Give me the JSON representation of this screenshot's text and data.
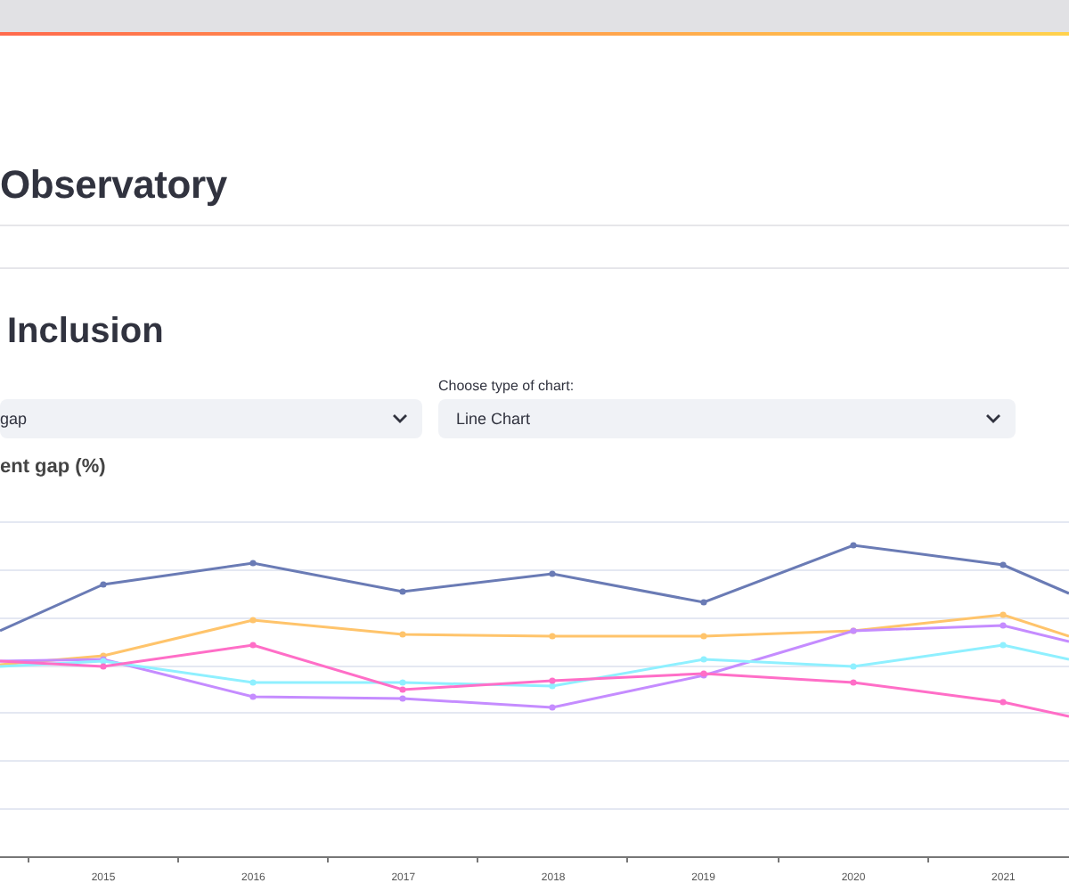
{
  "header": {
    "title": "Observatory"
  },
  "section": {
    "title": "Inclusion"
  },
  "selects": [
    {
      "value": "gap"
    },
    {
      "label": "Choose type of chart:",
      "value": "Line Chart"
    }
  ],
  "chart": {
    "title": "ent gap (%)",
    "x_labels": [
      "2015",
      "2016",
      "2017",
      "2018",
      "2019",
      "2020",
      "2021"
    ]
  }
}
